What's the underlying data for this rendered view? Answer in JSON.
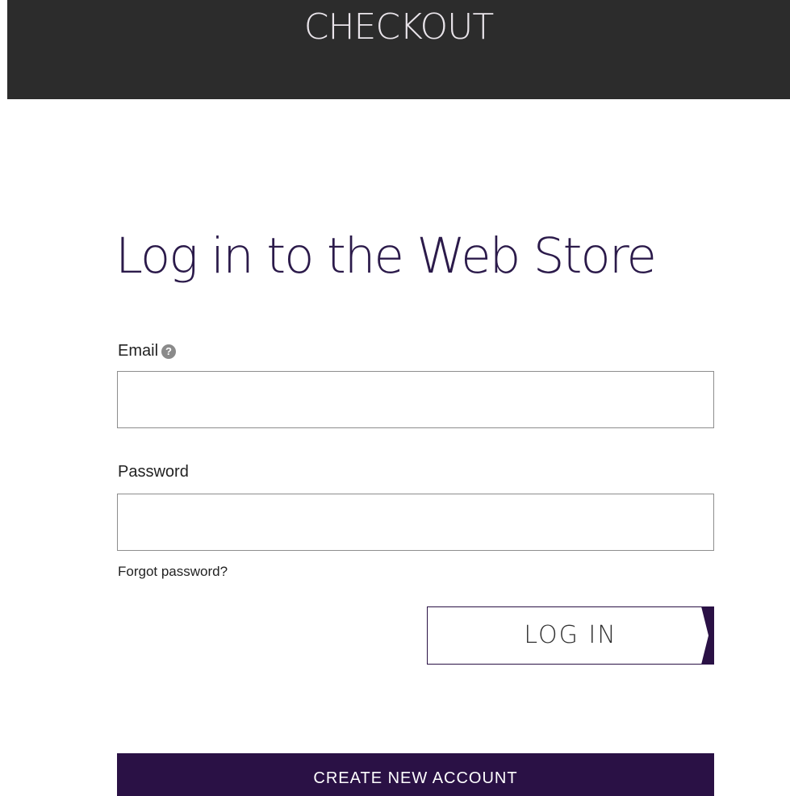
{
  "header": {
    "title": "CHECKOUT"
  },
  "main": {
    "title": "Log in to the Web Store"
  },
  "form": {
    "email": {
      "label": "Email",
      "help_icon": "?",
      "value": "",
      "placeholder": ""
    },
    "password": {
      "label": "Password",
      "value": "",
      "placeholder": ""
    },
    "forgot_password": "Forgot password?",
    "login_label": "LOG IN"
  },
  "create_account_label": "CREATE NEW ACCOUNT",
  "colors": {
    "header_bg": "#2c2c2c",
    "accent": "#2a1145",
    "title_text": "#2b1a4a"
  },
  "icons": {
    "help": "question-circle-icon",
    "login_arrow": "chevron-right-icon"
  }
}
